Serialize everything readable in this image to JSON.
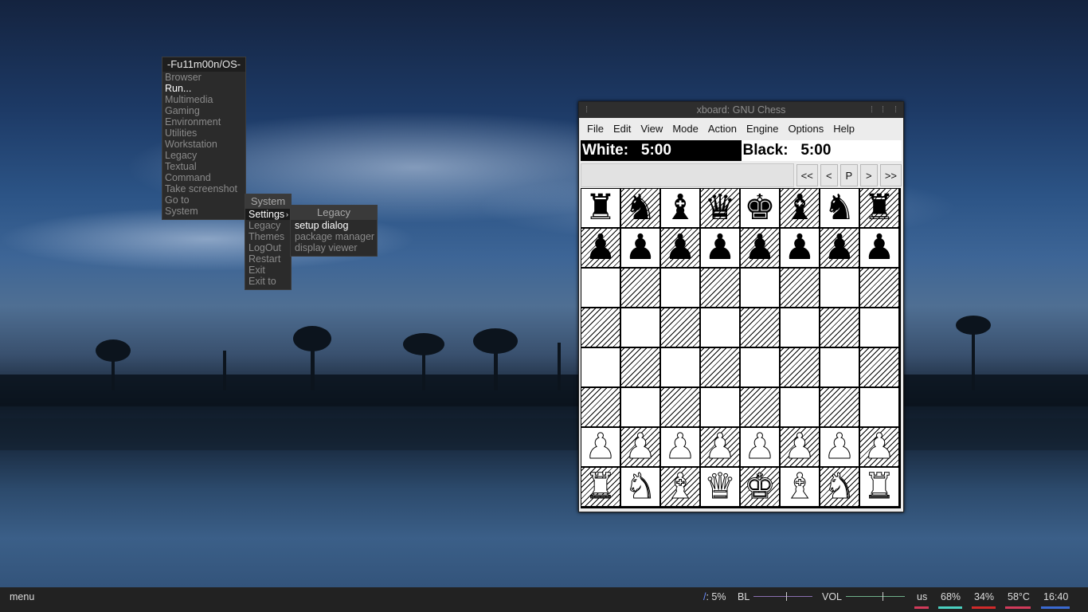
{
  "root_menu": {
    "title": "-Fu11m00n/OS-",
    "items": [
      {
        "label": "Browser",
        "state": "dim"
      },
      {
        "label": "Run...",
        "state": "bright"
      },
      {
        "label": "Multimedia",
        "state": "dim"
      },
      {
        "label": "Gaming",
        "state": "dim"
      },
      {
        "label": "Environment",
        "state": "dim"
      },
      {
        "label": "Utilities",
        "state": "dim"
      },
      {
        "label": "Workstation",
        "state": "dim"
      },
      {
        "label": "Legacy",
        "state": "dim"
      },
      {
        "label": "Textual",
        "state": "dim"
      },
      {
        "label": "Command",
        "state": "dim"
      },
      {
        "label": "Take screenshot",
        "state": "dim"
      },
      {
        "label": "Go to",
        "state": "dim"
      },
      {
        "label": "System",
        "state": "dim"
      }
    ]
  },
  "system_menu": {
    "title": "System",
    "items": [
      {
        "label": "Settings",
        "state": "selected",
        "submenu": true
      },
      {
        "label": "Legacy",
        "state": "dim"
      },
      {
        "label": "Themes",
        "state": "dim"
      },
      {
        "label": "LogOut",
        "state": "dim"
      },
      {
        "label": "Restart",
        "state": "dim"
      },
      {
        "label": "Exit",
        "state": "dim"
      },
      {
        "label": "Exit to",
        "state": "dim"
      }
    ]
  },
  "legacy_menu": {
    "title": "Legacy",
    "items": [
      {
        "label": "setup dialog",
        "state": "bright"
      },
      {
        "label": "package manager",
        "state": "dim"
      },
      {
        "label": "display viewer",
        "state": "dim"
      }
    ]
  },
  "xboard": {
    "title": "xboard: GNU Chess",
    "menubar": [
      "File",
      "Edit",
      "View",
      "Mode",
      "Action",
      "Engine",
      "Options",
      "Help"
    ],
    "white_clock": "White:   5:00",
    "black_clock": "Black:   5:00",
    "nav_buttons": [
      "<<",
      "<",
      "P",
      ">",
      ">>"
    ],
    "board": [
      [
        "br",
        "bn",
        "bb",
        "bq",
        "bk",
        "bb",
        "bn",
        "br"
      ],
      [
        "bp",
        "bp",
        "bp",
        "bp",
        "bp",
        "bp",
        "bp",
        "bp"
      ],
      [
        "",
        "",
        "",
        "",
        "",
        "",
        "",
        ""
      ],
      [
        "",
        "",
        "",
        "",
        "",
        "",
        "",
        ""
      ],
      [
        "",
        "",
        "",
        "",
        "",
        "",
        "",
        ""
      ],
      [
        "",
        "",
        "",
        "",
        "",
        "",
        "",
        ""
      ],
      [
        "wp",
        "wp",
        "wp",
        "wp",
        "wp",
        "wp",
        "wp",
        "wp"
      ],
      [
        "wr",
        "wn",
        "wb",
        "wq",
        "wk",
        "wb",
        "wn",
        "wr"
      ]
    ]
  },
  "taskbar": {
    "menu_label": "menu",
    "cpu_label": "/: 5%",
    "backlight_label": "BL",
    "backlight_level": 0.55,
    "volume_label": "VOL",
    "volume_level": 0.62,
    "keyboard_layout": "us",
    "battery": "68%",
    "memory": "34%",
    "temperature": "58°C",
    "clock": "16:40",
    "colors": {
      "slider": "#8a6fb0",
      "slider2": "#6fb08a",
      "us_underline": "#d23a5a",
      "battery_underline": "#4ad0c0",
      "memory_underline": "#d22a2a",
      "temp_underline": "#d23a5a",
      "clock_underline": "#3a6ad2"
    }
  }
}
